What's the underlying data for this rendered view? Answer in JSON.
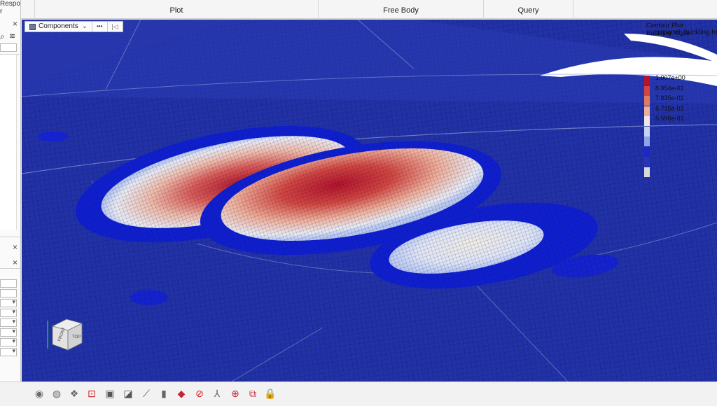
{
  "left_panel": {
    "top_title": "Response",
    "top_sub": "r",
    "close_glyph": "×"
  },
  "tabs": [
    {
      "label": ""
    },
    {
      "label": "Plot"
    },
    {
      "label": "Free Body"
    },
    {
      "label": "Query"
    },
    {
      "label": ""
    }
  ],
  "components_toolbar": {
    "label": "Components",
    "dropdown_glyph": "⌄",
    "more_glyph": "•••",
    "skip_glyph": "|◁"
  },
  "legend": {
    "title": "Contour Plot",
    "subtitle": "Buckling Mode",
    "file_name": "carpanel_buckling.hm*",
    "entries": [
      {
        "label": "1.007e+00",
        "color": "#b8122c"
      },
      {
        "label": "8.954e-01",
        "color": "#d2463f"
      },
      {
        "label": "7.835e-01",
        "color": "#e27a62"
      },
      {
        "label": "6.715e-01",
        "color": "#efb09a"
      },
      {
        "label": "5.596e-01",
        "color": "#eeeae3"
      },
      {
        "label": "",
        "color": "#c5d2f2"
      },
      {
        "label": "",
        "color": "#8fa4ea"
      },
      {
        "label": "",
        "color": "#1c27c6"
      },
      {
        "label": "",
        "color": "#2a35b5"
      },
      {
        "label": "",
        "color": "#d8d8d8"
      }
    ]
  },
  "view_cube": {
    "front": "FRONT",
    "top": "TOP"
  },
  "bottom_toolbar": [
    {
      "name": "eye-icon",
      "glyph": "◉",
      "color": "#6a6a6a"
    },
    {
      "name": "globe-icon",
      "glyph": "◍",
      "color": "#6a6a6a"
    },
    {
      "name": "rotate-icon",
      "glyph": "❖",
      "color": "#6a6a6a"
    },
    {
      "name": "fit-view-icon",
      "glyph": "⊡",
      "color": "#d02020"
    },
    {
      "name": "camera-icon",
      "glyph": "▣",
      "color": "#555"
    },
    {
      "name": "section-icon",
      "glyph": "◪",
      "color": "#555"
    },
    {
      "name": "measure-icon",
      "glyph": "⟋",
      "color": "#555"
    },
    {
      "name": "display-icon",
      "glyph": "▮",
      "color": "#666"
    },
    {
      "name": "isolate-icon",
      "glyph": "◆",
      "color": "#c0283a"
    },
    {
      "name": "hide-icon",
      "glyph": "⊘",
      "color": "#d02020"
    },
    {
      "name": "axis-icon",
      "glyph": "⅄",
      "color": "#666"
    },
    {
      "name": "search-icon",
      "glyph": "⊕",
      "color": "#c0283a"
    },
    {
      "name": "probe-icon",
      "glyph": "⧉",
      "color": "#c0283a"
    },
    {
      "name": "lock-icon",
      "glyph": "🔒",
      "color": "#c0283a"
    }
  ]
}
